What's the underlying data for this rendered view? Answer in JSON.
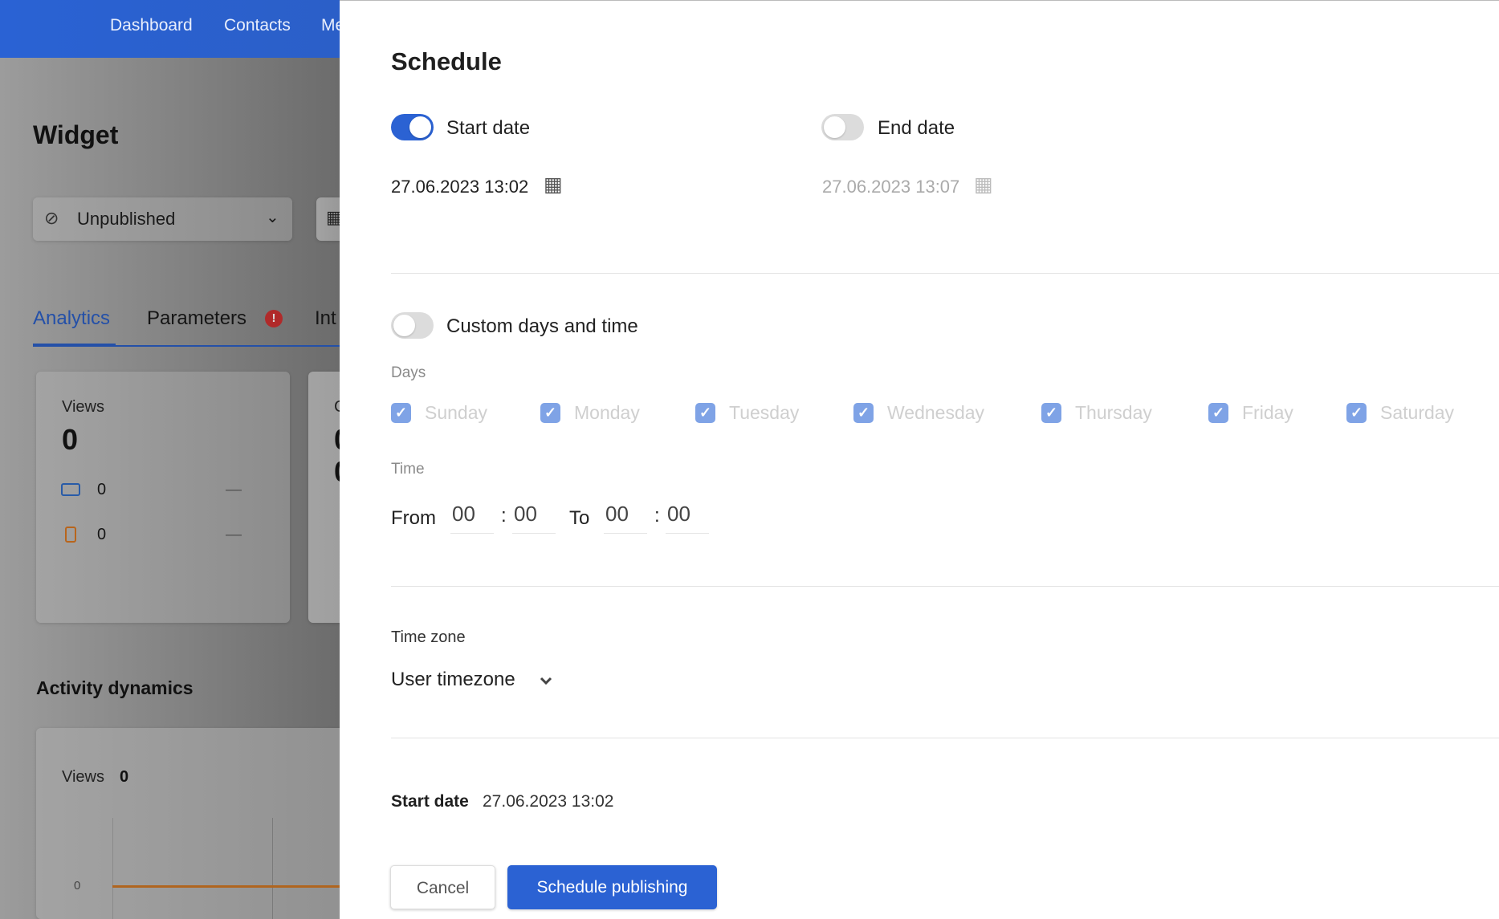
{
  "nav": {
    "items": [
      "Dashboard",
      "Contacts",
      "Me"
    ]
  },
  "page": {
    "title": "Widget",
    "status_select": "Unpublished",
    "tabs": [
      {
        "label": "Analytics",
        "active": true
      },
      {
        "label": "Parameters",
        "badge": "!"
      },
      {
        "label": "Int"
      }
    ],
    "views_card": {
      "label": "Views",
      "value": "0",
      "desktop": "0",
      "mobile": "0",
      "desktop_trend": "—",
      "mobile_trend": "—"
    },
    "second_card": {
      "label": "C",
      "value": "0",
      "value2": "0"
    },
    "activity": {
      "title": "Activity dynamics",
      "views_label": "Views",
      "views_value": "0",
      "y_tick": "0"
    }
  },
  "schedule": {
    "title": "Schedule",
    "start_toggle": {
      "label": "Start date",
      "on": true
    },
    "end_toggle": {
      "label": "End date",
      "on": false
    },
    "start_value": "27.06.2023 13:02",
    "end_value": "27.06.2023 13:07",
    "custom_toggle": {
      "label": "Custom days and time",
      "on": false
    },
    "days_label": "Days",
    "days": [
      {
        "label": "Sunday",
        "checked": true
      },
      {
        "label": "Monday",
        "checked": true
      },
      {
        "label": "Tuesday",
        "checked": true
      },
      {
        "label": "Wednesday",
        "checked": true
      },
      {
        "label": "Thursday",
        "checked": true
      },
      {
        "label": "Friday",
        "checked": true
      },
      {
        "label": "Saturday",
        "checked": true
      }
    ],
    "time_label": "Time",
    "from_label": "From",
    "from_h": "00",
    "from_m": "00",
    "to_label": "To",
    "to_h": "00",
    "to_m": "00",
    "colon": ":",
    "timezone_label": "Time zone",
    "timezone_value": "User timezone",
    "summary_label": "Start date",
    "summary_value": "27.06.2023 13:02",
    "cancel": "Cancel",
    "submit": "Schedule publishing"
  },
  "colors": {
    "accent": "#2b62d3",
    "checkbox_disabled": "#7fa3e6",
    "alert": "#d32f2f",
    "desktop": "#2f6fd0",
    "mobile": "#e07b22"
  }
}
